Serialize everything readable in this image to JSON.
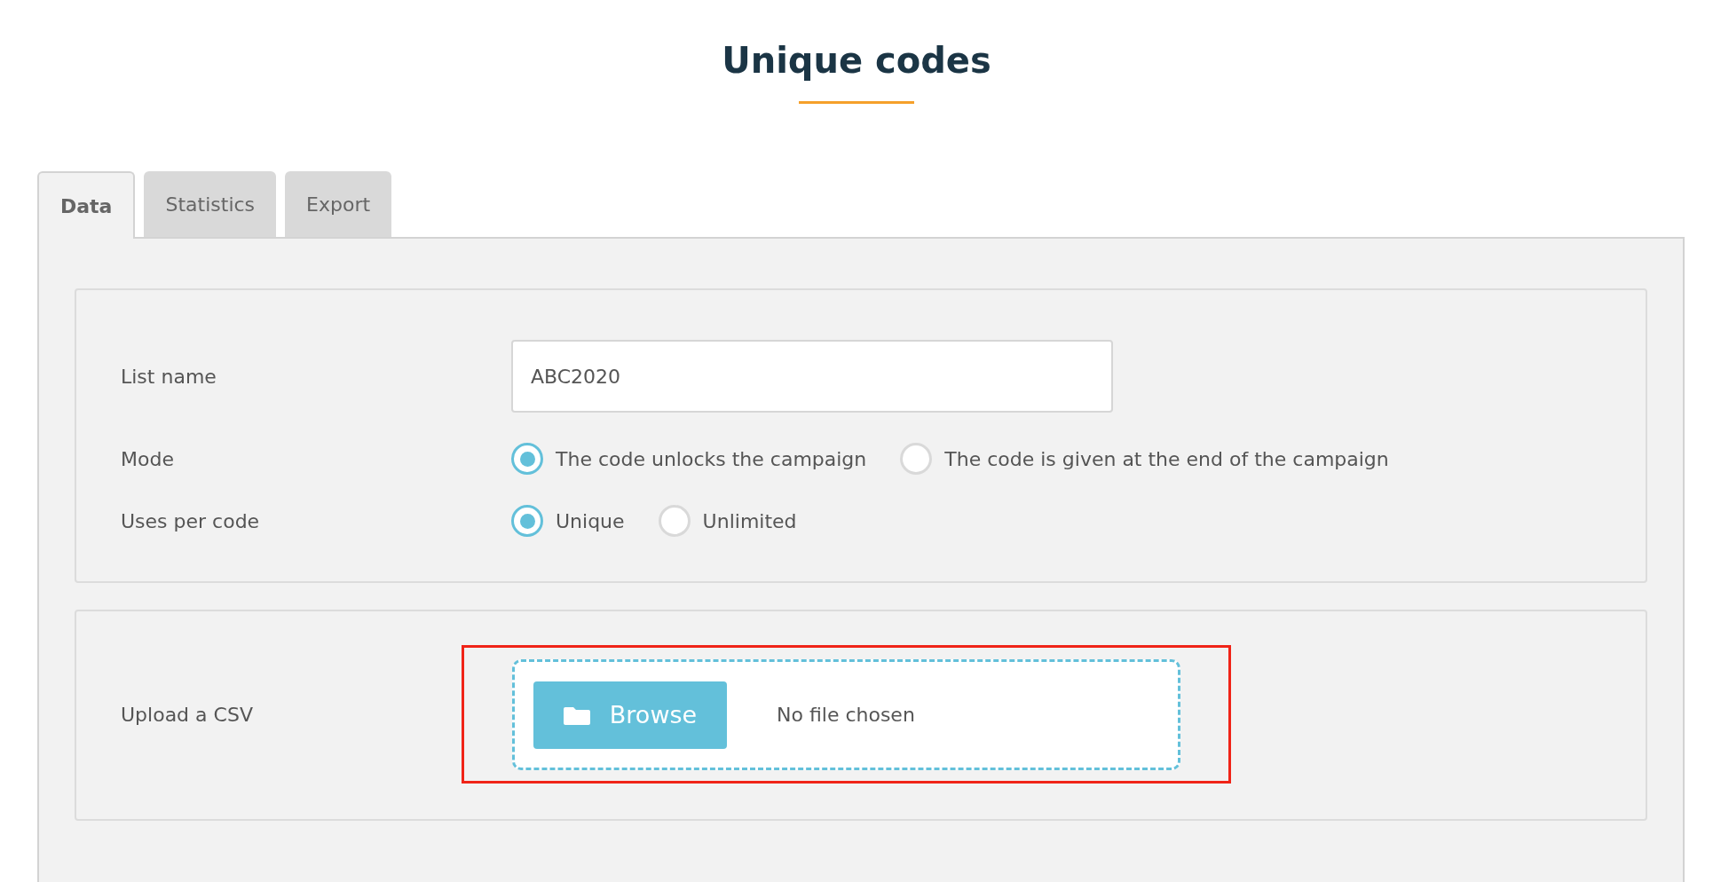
{
  "page": {
    "title": "Unique codes"
  },
  "tabs": [
    {
      "label": "Data",
      "selected": true
    },
    {
      "label": "Statistics",
      "selected": false
    },
    {
      "label": "Export",
      "selected": false
    }
  ],
  "settings": {
    "list_name": {
      "label": "List name",
      "value": "ABC2020"
    },
    "mode": {
      "label": "Mode",
      "options": [
        {
          "label": "The code unlocks the campaign",
          "selected": true
        },
        {
          "label": "The code is given at the end of the campaign",
          "selected": false
        }
      ]
    },
    "uses_per_code": {
      "label": "Uses per code",
      "options": [
        {
          "label": "Unique",
          "selected": true
        },
        {
          "label": "Unlimited",
          "selected": false
        }
      ]
    }
  },
  "upload": {
    "label": "Upload a CSV",
    "button": "Browse",
    "file_status": "No file chosen",
    "highlighted": true
  }
}
